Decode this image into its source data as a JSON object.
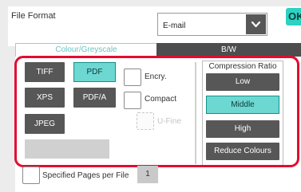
{
  "header": {
    "file_format_label": "File Format",
    "format_value": "E-mail",
    "ok_label": "OK"
  },
  "tabs": [
    {
      "label": "Colour/Greyscale",
      "active": true
    },
    {
      "label": "B/W",
      "active": false
    }
  ],
  "file_types": [
    {
      "label": "TIFF",
      "selected": false
    },
    {
      "label": "PDF",
      "selected": true
    },
    {
      "label": "XPS",
      "selected": false
    },
    {
      "label": "PDF/A",
      "selected": false
    },
    {
      "label": "JPEG",
      "selected": false
    }
  ],
  "options": {
    "encry_label": "Encry.",
    "compact_label": "Compact",
    "ufine_label": "U-Fine"
  },
  "compression": {
    "title": "Compression Ratio",
    "options": [
      "Low",
      "Middle",
      "High"
    ],
    "selected": "Middle",
    "reduce_colours_label": "Reduce Colours"
  },
  "specified_pages": {
    "label": "Specified Pages per File",
    "value": "1"
  },
  "colors": {
    "accent": "#6dd7d2",
    "ok": "#2cd2c3",
    "highlight": "#e30c30",
    "button": "#575757"
  },
  "icons": [
    "chevron-down-icon"
  ]
}
